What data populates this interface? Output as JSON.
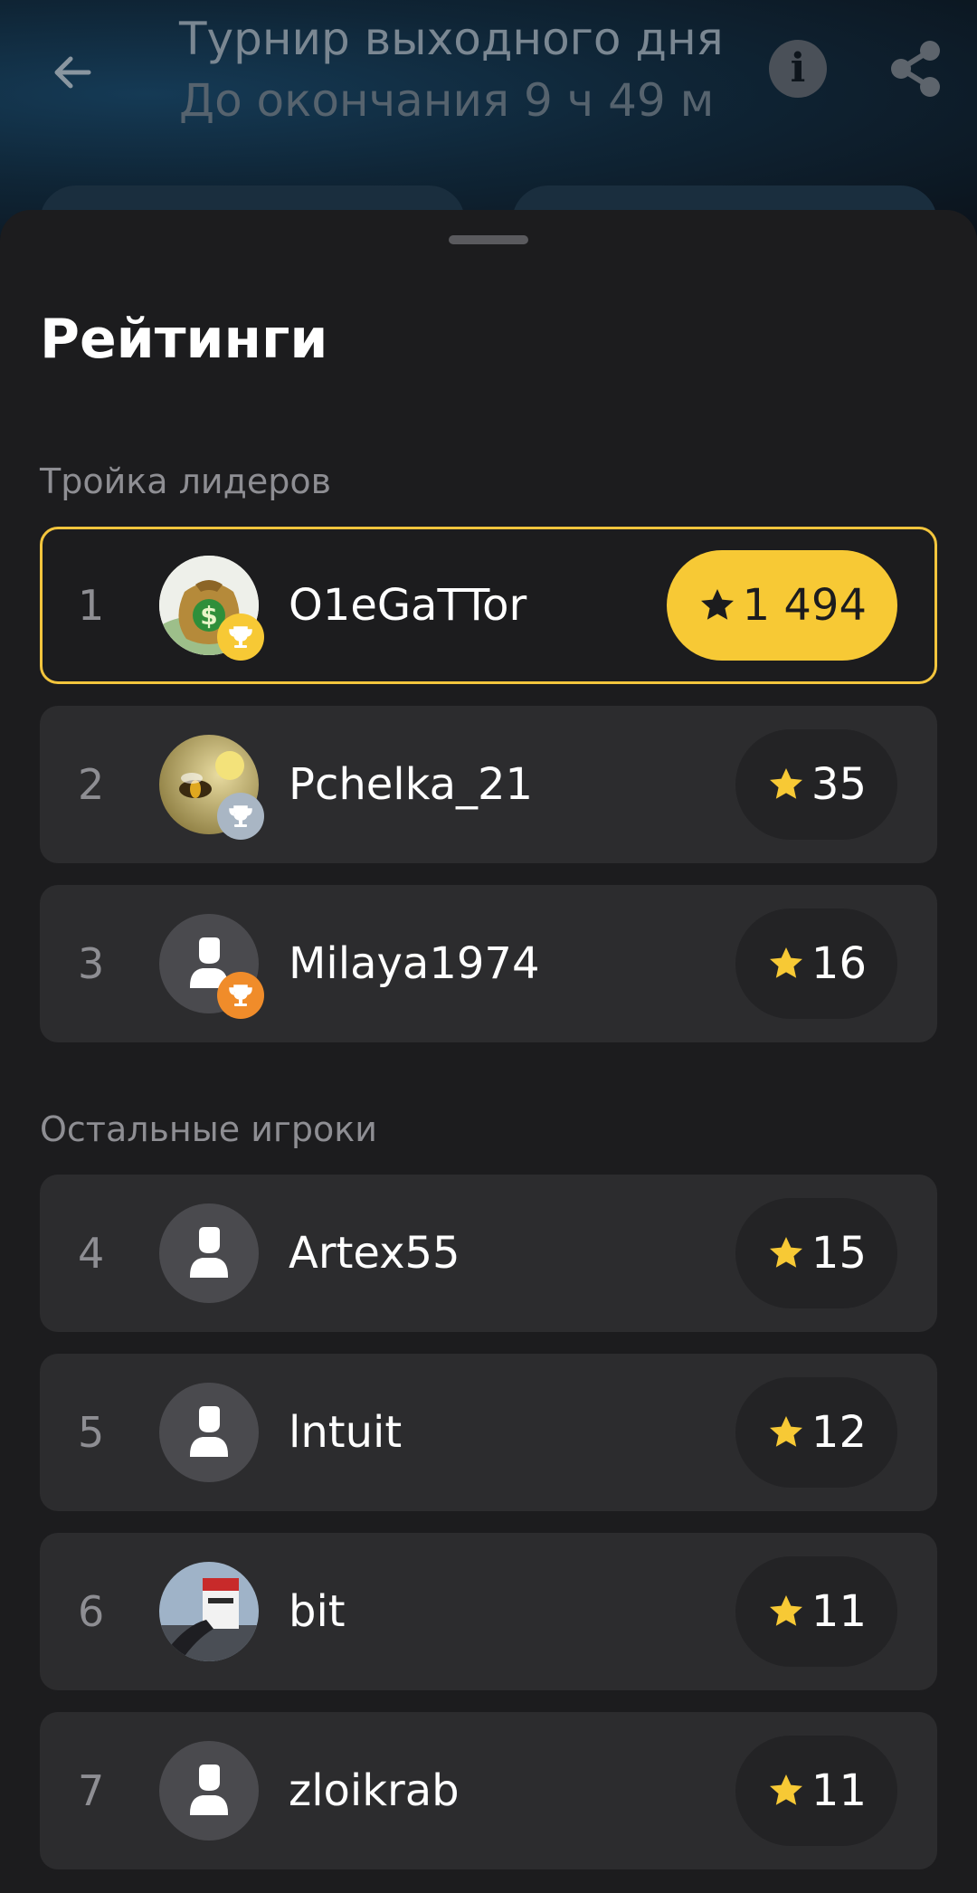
{
  "header": {
    "title": "Турнир выходного дня",
    "subtitle": "До окончания 9 ч 49 м"
  },
  "sheet": {
    "title": "Рейтинги",
    "leaders_label": "Тройка лидеров",
    "others_label": "Остальные игроки"
  },
  "colors": {
    "gold": "#f7c935",
    "silver": "#a9b6c4",
    "bronze": "#f08c2a"
  },
  "leaders": [
    {
      "rank": "1",
      "name": "O1eGaTTor",
      "score": "1 494",
      "trophy": "gold",
      "avatar": "money-bag-avatar"
    },
    {
      "rank": "2",
      "name": "Pchelka_21",
      "score": "35",
      "trophy": "silver",
      "avatar": "bee-avatar"
    },
    {
      "rank": "3",
      "name": "Milaya1974",
      "score": "16",
      "trophy": "bronze",
      "avatar": "default-user-avatar"
    }
  ],
  "others": [
    {
      "rank": "4",
      "name": "Artex55",
      "score": "15",
      "avatar": "default-user-avatar"
    },
    {
      "rank": "5",
      "name": "lntuit",
      "score": "12",
      "avatar": "default-user-avatar"
    },
    {
      "rank": "6",
      "name": "bit",
      "score": "11",
      "avatar": "photo-avatar"
    },
    {
      "rank": "7",
      "name": "zloikrab",
      "score": "11",
      "avatar": "default-user-avatar"
    }
  ]
}
